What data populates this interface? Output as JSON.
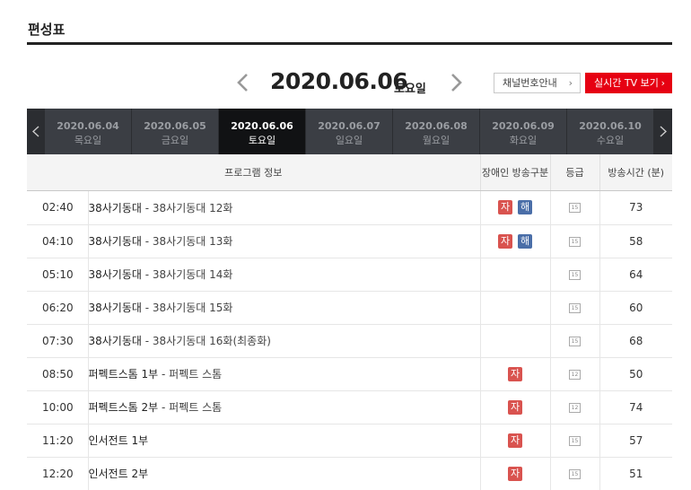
{
  "page_title": "편성표",
  "date_nav": {
    "current_date": "2020.06.06",
    "current_day": "토요일",
    "channel_info_label": "채널번호안내",
    "live_tv_label": "실시간 TV 보기"
  },
  "date_tabs": [
    {
      "date": "2020.06.04",
      "day": "목요일",
      "active": false
    },
    {
      "date": "2020.06.05",
      "day": "금요일",
      "active": false
    },
    {
      "date": "2020.06.06",
      "day": "토요일",
      "active": true
    },
    {
      "date": "2020.06.07",
      "day": "일요일",
      "active": false
    },
    {
      "date": "2020.06.08",
      "day": "월요일",
      "active": false
    },
    {
      "date": "2020.06.09",
      "day": "화요일",
      "active": false
    },
    {
      "date": "2020.06.10",
      "day": "수요일",
      "active": false
    }
  ],
  "table": {
    "headers": {
      "program": "프로그램 정보",
      "accessibility": "장애인 방송구분",
      "rating": "등급",
      "duration": "방송시간 (분)"
    },
    "rows": [
      {
        "time": "02:40",
        "title": "38사기동대",
        "episode": "38사기동대 12화",
        "ja": "자",
        "hae": "해",
        "rating": "15",
        "duration": "73"
      },
      {
        "time": "04:10",
        "title": "38사기동대",
        "episode": "38사기동대 13화",
        "ja": "자",
        "hae": "해",
        "rating": "15",
        "duration": "58"
      },
      {
        "time": "05:10",
        "title": "38사기동대",
        "episode": "38사기동대 14화",
        "ja": "",
        "hae": "",
        "rating": "15",
        "duration": "64"
      },
      {
        "time": "06:20",
        "title": "38사기동대",
        "episode": "38사기동대 15화",
        "ja": "",
        "hae": "",
        "rating": "15",
        "duration": "60"
      },
      {
        "time": "07:30",
        "title": "38사기동대",
        "episode": "38사기동대 16화(최종화)",
        "ja": "",
        "hae": "",
        "rating": "15",
        "duration": "68"
      },
      {
        "time": "08:50",
        "title": "퍼펙트스톰 1부",
        "episode": "퍼펙트 스톰",
        "ja": "자",
        "hae": "",
        "rating": "12",
        "duration": "50"
      },
      {
        "time": "10:00",
        "title": "퍼펙트스톰 2부",
        "episode": "퍼펙트 스톰",
        "ja": "자",
        "hae": "",
        "rating": "12",
        "duration": "74"
      },
      {
        "time": "11:20",
        "title": "인서전트 1부",
        "episode": "",
        "ja": "자",
        "hae": "",
        "rating": "15",
        "duration": "57"
      },
      {
        "time": "12:20",
        "title": "인서전트 2부",
        "episode": "",
        "ja": "자",
        "hae": "",
        "rating": "15",
        "duration": "51"
      }
    ]
  },
  "icons": {
    "prev_date": "chevron-left-icon",
    "next_date": "chevron-right-icon",
    "rating": "age-rating-icon"
  },
  "colors": {
    "live_button": "#e60012",
    "strip_bg": "#3b3e44",
    "active_tab": "#111214",
    "badge_ja": "#d9534f",
    "badge_hae": "#4a6ea8"
  }
}
